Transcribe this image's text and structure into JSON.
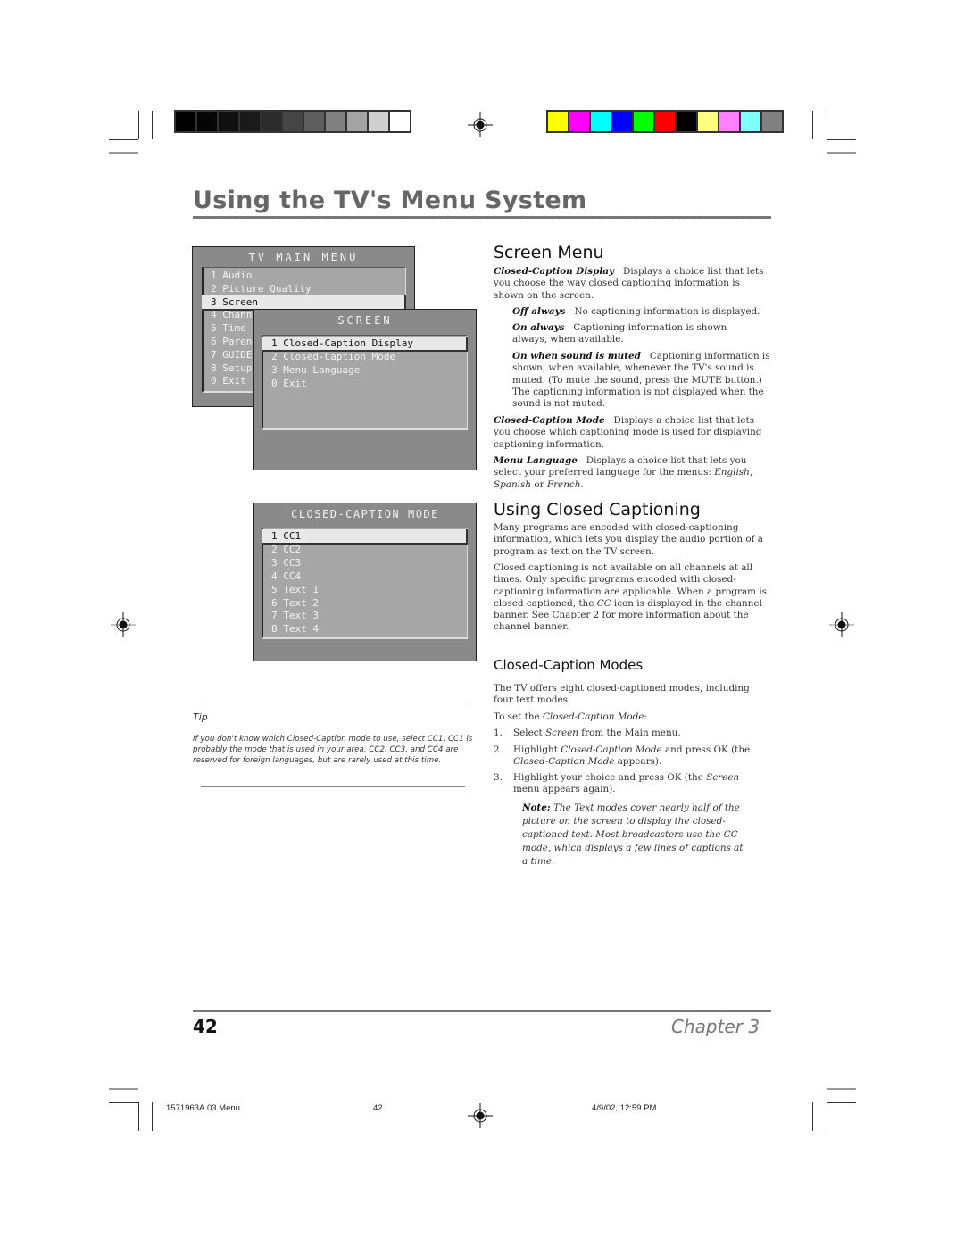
{
  "print_marks": {
    "grayscale_bars": [
      "#000000",
      "#050505",
      "#0f0f0f",
      "#1a1a1a",
      "#2b2b2b",
      "#454545",
      "#5e5e5e",
      "#808080",
      "#a3a3a3",
      "#cfcfcf",
      "#ffffff"
    ],
    "color_bars": [
      "#ffff00",
      "#ff00ff",
      "#00ffff",
      "#0000ff",
      "#00ff00",
      "#ff0000",
      "#000000",
      "#ffff80",
      "#ff80ff",
      "#80ffff",
      "#808080"
    ]
  },
  "page": {
    "title": "Using the TV's Menu System",
    "page_number": "42",
    "chapter": "Chapter 3"
  },
  "tv_main_menu": {
    "title": "TV MAIN MENU",
    "items": [
      {
        "label": "1 Audio"
      },
      {
        "label": "2 Picture Quality"
      },
      {
        "label": "3 Screen",
        "selected": true
      },
      {
        "label": "4 Chann"
      },
      {
        "label": "5 Time"
      },
      {
        "label": "6 Paren"
      },
      {
        "label": "7 GUIDE"
      },
      {
        "label": "8 Setup"
      },
      {
        "label": "0 Exit"
      }
    ]
  },
  "screen_menu": {
    "title": "SCREEN",
    "items": [
      {
        "label": "1 Closed-Caption Display",
        "selected": true
      },
      {
        "label": "2 Closed-Caption Mode"
      },
      {
        "label": "3 Menu Language"
      },
      {
        "label": "0 Exit"
      }
    ]
  },
  "cc_mode_menu": {
    "title": "CLOSED-CAPTION MODE",
    "items": [
      {
        "label": "1 CC1",
        "selected": true
      },
      {
        "label": "2 CC2"
      },
      {
        "label": "3 CC3"
      },
      {
        "label": "4 CC4"
      },
      {
        "label": "5 Text 1"
      },
      {
        "label": "6 Text 2"
      },
      {
        "label": "7 Text 3"
      },
      {
        "label": "8 Text 4"
      }
    ]
  },
  "screen_menu_section": {
    "heading": "Screen Menu",
    "cc_display_term": "Closed-Caption Display",
    "cc_display_desc": "Displays a choice list that lets you choose the way closed captioning information is shown on the screen.",
    "options": [
      {
        "term": "Off always",
        "desc": "No captioning information is displayed."
      },
      {
        "term": "On always",
        "desc": "Captioning information is shown always, when available."
      },
      {
        "term": "On when sound is muted",
        "desc": "Captioning information is shown, when available, whenever the TV's sound is muted. (To mute the sound, press the MUTE button.) The captioning information is not displayed when the sound is not muted."
      }
    ],
    "cc_mode_term": "Closed-Caption Mode",
    "cc_mode_desc": "Displays a choice list that lets you choose which captioning mode is used for displaying captioning information.",
    "menu_lang_term": "Menu Language",
    "menu_lang_desc": "Displays a choice list that lets you select your preferred language for the menus:",
    "lang_english": "English",
    "lang_spanish": "Spanish",
    "lang_or": "or",
    "lang_french": "French"
  },
  "using_cc_section": {
    "heading": "Using Closed Captioning",
    "para1": "Many programs are encoded with closed-captioning information, which lets you display the audio portion of a program as text on the TV screen.",
    "para2_a": "Closed captioning is not available on all channels at all times. Only specific programs encoded with closed-captioning information are applicable. When a program is closed captioned, the",
    "para2_cc": "CC",
    "para2_b": "icon is displayed in the channel banner. See Chapter 2 for more information about the channel banner."
  },
  "cc_modes_section": {
    "heading": "Closed-Caption Modes",
    "intro": "The TV offers eight closed-captioned modes, including four text modes.",
    "to_set": "To set the",
    "to_set_term": "Closed-Caption Mode",
    "steps": [
      {
        "num": "1.",
        "a": "Select",
        "term": "Screen",
        "b": "from the Main menu."
      },
      {
        "num": "2.",
        "a": "Highlight",
        "term": "Closed-Caption Mode",
        "b": "and press OK  (the",
        "term2": "Closed-Caption Mode",
        "c": "appears)."
      },
      {
        "num": "3.",
        "a": "Highlight your choice and press OK (the",
        "term": "Screen",
        "b": "menu appears again)."
      }
    ],
    "note_label": "Note:",
    "note_text": "The Text modes cover nearly half of the picture on the screen to display the closed-captioned text. Most broadcasters use the CC mode, which displays a few lines of captions at a time."
  },
  "tip": {
    "label": "Tip",
    "text": "If you don't know which Closed-Caption mode to use, select CC1. CC1 is probably the mode that is used in your area. CC2, CC3, and CC4  are reserved for foreign languages, but are rarely used at this time."
  },
  "slug": {
    "file": "1571963A.03 Menu",
    "page": "42",
    "date": "4/9/02, 12:59 PM"
  }
}
